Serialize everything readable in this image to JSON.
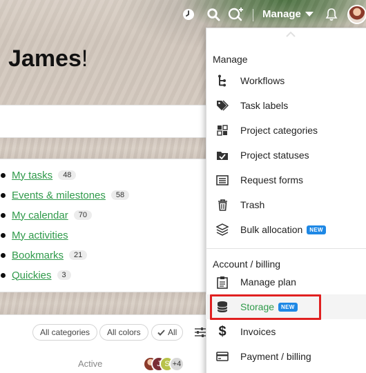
{
  "greeting": {
    "name": "James",
    "punctuation": "!"
  },
  "toolbar": {
    "manage_label": "Manage",
    "icons": [
      "clock-icon",
      "search-icon",
      "add-icon",
      "bell-icon"
    ]
  },
  "quick_links": [
    {
      "label": "My tasks",
      "count": "48"
    },
    {
      "label": "Events & milestones",
      "count": "58"
    },
    {
      "label": "My calendar",
      "count": "70"
    },
    {
      "label": "My activities",
      "count": ""
    },
    {
      "label": "Bookmarks",
      "count": "21"
    },
    {
      "label": "Quickies",
      "count": "3"
    }
  ],
  "filters": {
    "categories": "All categories",
    "colors": "All colors",
    "all": "All"
  },
  "activity": {
    "status": "Active",
    "avatars": [
      "J",
      "S"
    ],
    "more": "+4"
  },
  "menu": {
    "manage_heading": "Manage",
    "manage_items": [
      {
        "label": "Workflows",
        "icon": "workflow-icon",
        "badge": ""
      },
      {
        "label": "Task labels",
        "icon": "tag-icon",
        "badge": ""
      },
      {
        "label": "Project categories",
        "icon": "categories-icon",
        "badge": ""
      },
      {
        "label": "Project statuses",
        "icon": "folder-check-icon",
        "badge": ""
      },
      {
        "label": "Request forms",
        "icon": "form-icon",
        "badge": ""
      },
      {
        "label": "Trash",
        "icon": "trash-icon",
        "badge": ""
      },
      {
        "label": "Bulk allocation",
        "icon": "layers-icon",
        "badge": "NEW"
      }
    ],
    "billing_heading": "Account / billing",
    "billing_items": [
      {
        "label": "Manage plan",
        "icon": "clipboard-icon",
        "badge": ""
      },
      {
        "label": "Storage",
        "icon": "database-icon",
        "badge": "NEW"
      },
      {
        "label": "Invoices",
        "icon": "dollar-icon",
        "badge": ""
      },
      {
        "label": "Payment / billing",
        "icon": "credit-card-icon",
        "badge": ""
      }
    ]
  },
  "colors": {
    "link": "#2f9a4a",
    "badge": "#1e88e5",
    "highlight": "#e02020"
  }
}
